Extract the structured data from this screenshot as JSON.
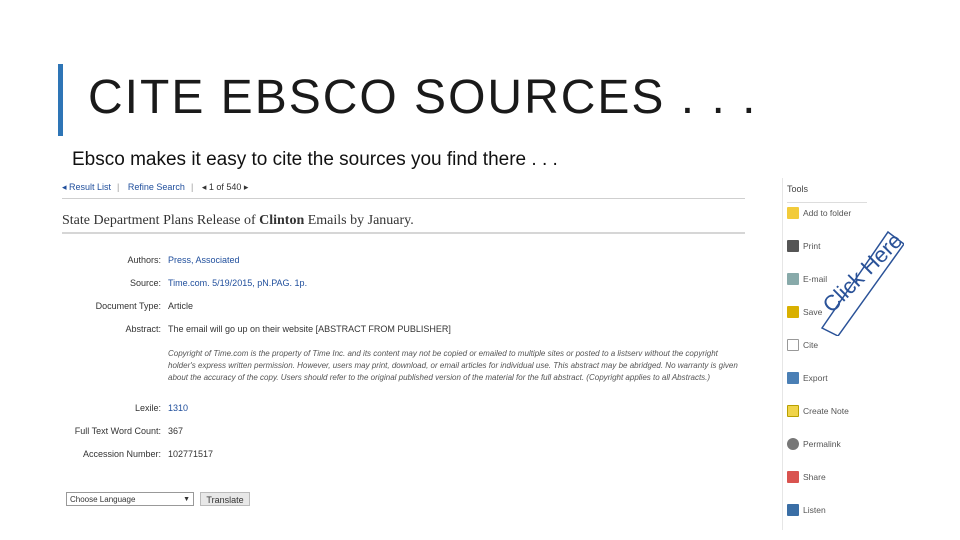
{
  "slide": {
    "title": "CITE EBSCO SOURCES . . .",
    "subtitle": "Ebsco makes it easy to cite the sources you find there . . ."
  },
  "nav": {
    "result_list": "◂ Result List",
    "refine_search": "Refine Search",
    "pager": "◂ 1 of 540 ▸"
  },
  "article": {
    "title_pre": "State Department Plans Release of ",
    "title_bold": "Clinton",
    "title_post": " Emails by January.",
    "fields": {
      "authors_label": "Authors:",
      "authors_value": "Press, Associated",
      "source_label": "Source:",
      "source_value": "Time.com. 5/19/2015, pN.PAG. 1p.",
      "doctype_label": "Document Type:",
      "doctype_value": "Article",
      "abstract_label": "Abstract:",
      "abstract_value": "The email will go up on their website [ABSTRACT FROM PUBLISHER]",
      "copyright_text": "Copyright of Time.com is the property of Time Inc. and its content may not be copied or emailed to multiple sites or posted to a listserv without the copyright holder's express written permission. However, users may print, download, or email articles for individual use. This abstract may be abridged. No warranty is given about the accuracy of the copy. Users should refer to the original published version of the material for the full abstract. (Copyright applies to all Abstracts.)",
      "lexile_label": "Lexile:",
      "lexile_value": "1310",
      "wordcount_label": "Full Text Word Count:",
      "wordcount_value": "367",
      "accession_label": "Accession Number:",
      "accession_value": "102771517"
    }
  },
  "language": {
    "select_value": "Choose Language",
    "translate_label": "Translate"
  },
  "tools": {
    "heading": "Tools",
    "items": [
      {
        "label": "Add to folder",
        "icon": "folder-icon"
      },
      {
        "label": "Print",
        "icon": "printer-icon"
      },
      {
        "label": "E-mail",
        "icon": "email-icon"
      },
      {
        "label": "Save",
        "icon": "save-icon"
      },
      {
        "label": "Cite",
        "icon": "cite-icon"
      },
      {
        "label": "Export",
        "icon": "export-icon"
      },
      {
        "label": "Create Note",
        "icon": "note-icon"
      },
      {
        "label": "Permalink",
        "icon": "permalink-icon"
      },
      {
        "label": "Share",
        "icon": "share-icon"
      },
      {
        "label": "Listen",
        "icon": "listen-icon"
      }
    ]
  },
  "callout": {
    "text": "Click Here",
    "color": "#2a5298"
  }
}
